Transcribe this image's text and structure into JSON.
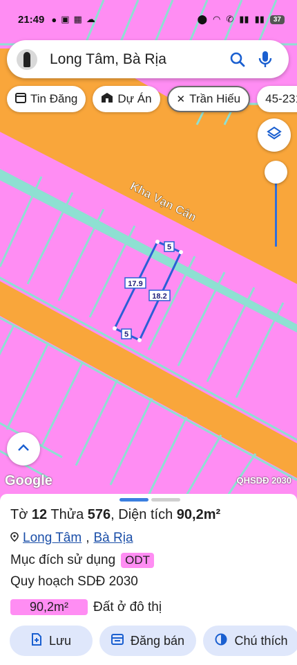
{
  "status": {
    "time": "21:49",
    "battery": "37"
  },
  "search": {
    "query": "Long Tâm, Bà Rịa"
  },
  "chips": [
    {
      "label": "Tin Đăng",
      "icon": "calendar-icon"
    },
    {
      "label": "Dự Án",
      "icon": "building-icon"
    },
    {
      "label": "Trần Hiếu",
      "icon": "tools-icon"
    },
    {
      "label": "45-231",
      "icon": ""
    }
  ],
  "map": {
    "road_label": "Kha Vạn Cân",
    "dims": {
      "top": "5",
      "left": "17.9",
      "right": "18.2",
      "bottom": "5"
    },
    "google_label": "Google",
    "layer_tag": "QHSDĐ 2030",
    "colors": {
      "parcel": "#ff8df3",
      "road": "#f9a63b",
      "border": "#8ee0d2",
      "plot_outline": "#2a5fd6"
    }
  },
  "sheet": {
    "title_prefix": "Tờ",
    "sheet_no": "12",
    "parcel_prefix": "Thửa",
    "parcel_no": "576",
    "area_prefix": "Diện tích",
    "area": "90,2m²",
    "ward": "Long Tâm",
    "city": "Bà Rịa",
    "purpose_label": "Mục đích sử dụng",
    "purpose_code": "ODT",
    "planning_label": "Quy hoạch SDĐ 2030",
    "plan_area": "90,2m²",
    "plan_desc": "Đất ở đô thị",
    "actions": [
      {
        "label": "Lưu",
        "icon": "save-icon"
      },
      {
        "label": "Đăng bán",
        "icon": "listing-icon"
      },
      {
        "label": "Chú thích",
        "icon": "legend-icon"
      }
    ]
  }
}
